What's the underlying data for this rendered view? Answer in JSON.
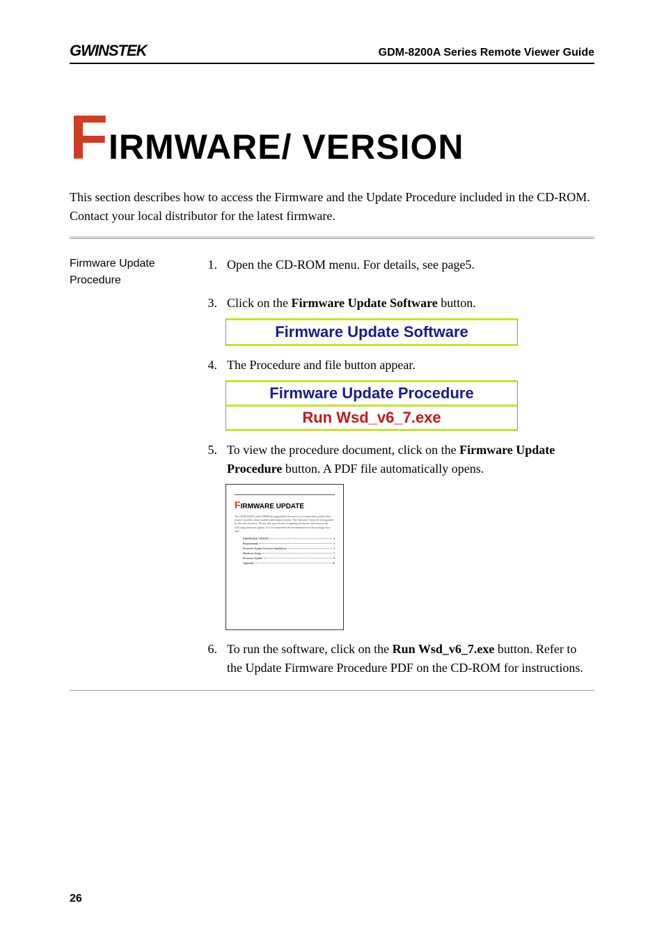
{
  "header": {
    "logo": "GWINSTEK",
    "titleRight": "GDM-8200A Series Remote Viewer Guide"
  },
  "mainTitle": {
    "firstLetter": "F",
    "rest": "IRMWARE/ VERSION"
  },
  "intro": "This section describes how to access the Firmware and the Update Procedure included in the CD-ROM. Contact your local distributor for the latest firmware.",
  "section": {
    "label": "Firmware Update Procedure",
    "steps": [
      {
        "num": "1.",
        "text_before": "Open the CD-ROM menu. For details, see page5.",
        "bold": "",
        "text_after": ""
      },
      {
        "num": "3.",
        "text_before": "Click on the ",
        "bold": "Firmware Update Software",
        "text_after": " button."
      },
      {
        "num": "4.",
        "text_before": "The Procedure and file button appear.",
        "bold": "",
        "text_after": ""
      },
      {
        "num": "5.",
        "text_before": "To view the procedure document, click on the ",
        "bold": "Firmware Update Procedure",
        "text_after": " button. A PDF file automatically opens."
      },
      {
        "num": "6.",
        "text_before": "To run the software, click on the ",
        "bold": "Run Wsd_v6_7.exe",
        "text_after": " button. Refer to the Update Firmware Procedure PDF on the CD-ROM for instructions."
      }
    ]
  },
  "buttons": {
    "fwSoftware": "Firmware Update Software",
    "fwProcedure": "Firmware Update Procedure",
    "runExe": "Run Wsd_v6_7.exe"
  },
  "pdf": {
    "tPrefix": "F",
    "tRest": "IRMWARE UPDATE",
    "toc": [
      {
        "label": "FIRMWARE UPDATE",
        "page": "3"
      },
      {
        "label": "Requirements",
        "page": "3"
      },
      {
        "label": "Firmware Update Software Installation",
        "page": "4"
      },
      {
        "label": "Hardware Setup",
        "page": "7"
      },
      {
        "label": "Firmware Update",
        "page": "8"
      },
      {
        "label": "Appendix",
        "page": "16"
      }
    ]
  },
  "pageNumber": "26"
}
